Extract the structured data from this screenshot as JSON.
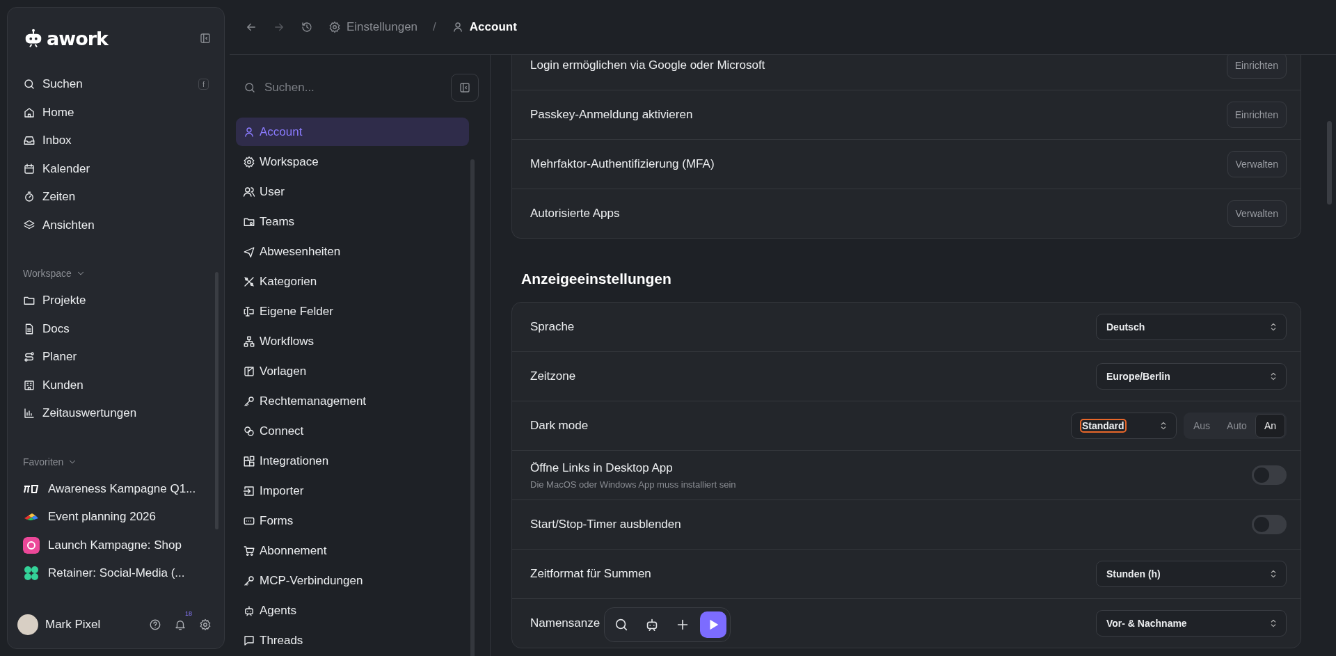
{
  "brand": {
    "name": "awork"
  },
  "main_nav": [
    {
      "label": "Suchen",
      "shortcut": "f"
    },
    {
      "label": "Home"
    },
    {
      "label": "Inbox"
    },
    {
      "label": "Kalender"
    },
    {
      "label": "Zeiten"
    },
    {
      "label": "Ansichten"
    }
  ],
  "workspace": {
    "title": "Workspace",
    "expanded": true,
    "items": [
      "Projekte",
      "Docs",
      "Planer",
      "Kunden",
      "Zeitauswertungen"
    ]
  },
  "favorites": {
    "title": "Favoriten",
    "expanded": true,
    "items": [
      "Awareness Kampagne Q1...",
      "Event planning 2026",
      "Launch Kampagne: Shop",
      "Retainer: Social-Media (..."
    ]
  },
  "user": {
    "name": "Mark Pixel",
    "notifications": "18"
  },
  "breadcrumb": [
    "Einstellungen",
    "Account"
  ],
  "breadcrumb_separator": "/",
  "settings_search": {
    "placeholder": "Suchen..."
  },
  "settings_nav": [
    {
      "label": "Account",
      "selected": true
    },
    {
      "label": "Workspace",
      "selected": false
    },
    {
      "label": "User",
      "selected": false
    },
    {
      "label": "Teams",
      "selected": false
    },
    {
      "label": "Abwesenheiten",
      "selected": false
    },
    {
      "label": "Kategorien",
      "selected": false
    },
    {
      "label": "Eigene Felder",
      "selected": false
    },
    {
      "label": "Workflows",
      "selected": false
    },
    {
      "label": "Vorlagen",
      "selected": false
    },
    {
      "label": "Rechtemanagement",
      "selected": false
    },
    {
      "label": "Connect",
      "selected": false
    },
    {
      "label": "Integrationen",
      "selected": false
    },
    {
      "label": "Importer",
      "selected": false
    },
    {
      "label": "Forms",
      "selected": false
    },
    {
      "label": "Abonnement",
      "selected": false
    },
    {
      "label": "MCP-Verbindungen",
      "selected": false
    },
    {
      "label": "Agents",
      "selected": false
    },
    {
      "label": "Threads",
      "selected": false
    }
  ],
  "security_rows": [
    {
      "label": "Login ermöglichen via Google oder Microsoft",
      "button": "Einrichten"
    },
    {
      "label": "Passkey-Anmeldung aktivieren",
      "button": "Einrichten"
    },
    {
      "label": "Mehrfaktor-Authentifizierung (MFA)",
      "button": "Verwalten"
    },
    {
      "label": "Autorisierte Apps",
      "button": "Verwalten"
    }
  ],
  "display_section": {
    "title": "Anzeigeeinstellungen",
    "rows": [
      {
        "kind": "select",
        "label": "Sprache",
        "value": "Deutsch"
      },
      {
        "kind": "select",
        "label": "Zeitzone",
        "value": "Europe/Berlin"
      },
      {
        "kind": "segmented",
        "label": "Dark mode",
        "value": "Standard",
        "focused": true,
        "options": [
          {
            "label": "Aus",
            "selected": false
          },
          {
            "label": "Auto",
            "selected": false
          },
          {
            "label": "An",
            "selected": true
          }
        ]
      },
      {
        "kind": "toggle",
        "label": "Öffne Links in Desktop App",
        "description": "Die MacOS oder Windows App muss installiert sein",
        "on": false
      },
      {
        "kind": "toggle",
        "label": "Start/Stop-Timer ausblenden",
        "on": false
      },
      {
        "kind": "select",
        "label": "Zeitformat für Summen",
        "value": "Stunden (h)"
      },
      {
        "kind": "select",
        "label": "Namensanze",
        "value": "Vor- & Nachname"
      }
    ]
  }
}
